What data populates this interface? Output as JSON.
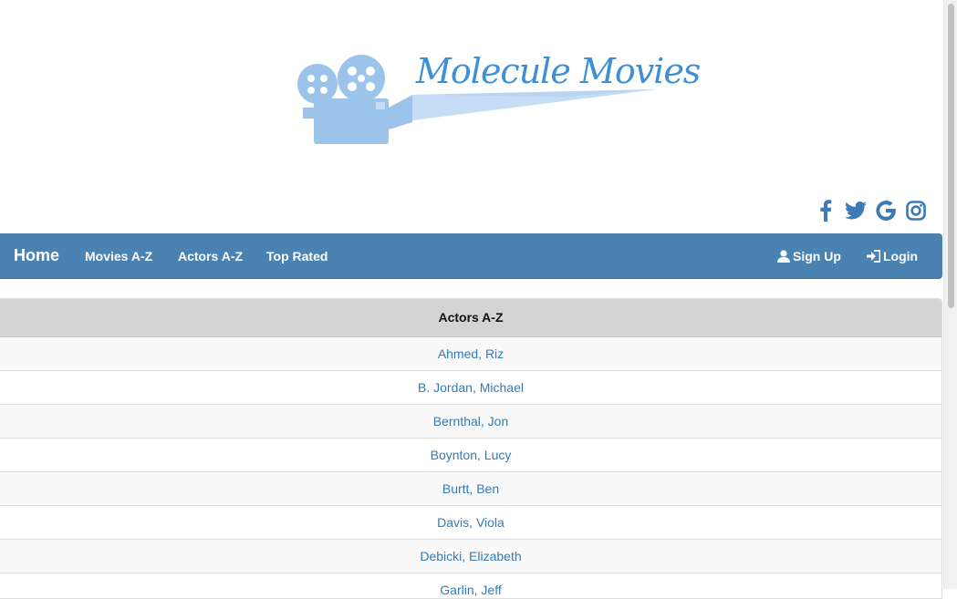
{
  "logo": {
    "text": "Molecule Movies",
    "icon": "film-camera-icon"
  },
  "social": [
    {
      "icon": "facebook-icon"
    },
    {
      "icon": "twitter-icon"
    },
    {
      "icon": "google-icon"
    },
    {
      "icon": "instagram-icon"
    }
  ],
  "navbar": {
    "brand": "Home",
    "links": [
      "Movies A-Z",
      "Actors A-Z",
      "Top Rated"
    ],
    "signup": "Sign Up",
    "login": "Login"
  },
  "table": {
    "header": "Actors A-Z",
    "rows": [
      "Ahmed, Riz",
      "B. Jordan, Michael",
      "Bernthal, Jon",
      "Boynton, Lucy",
      "Burtt, Ben",
      "Davis, Viola",
      "Debicki, Elizabeth",
      "Garlin, Jeff"
    ]
  },
  "colors": {
    "navbar": "#4a82b2",
    "link": "#337ab7",
    "header_bg": "#d4d4d4"
  }
}
